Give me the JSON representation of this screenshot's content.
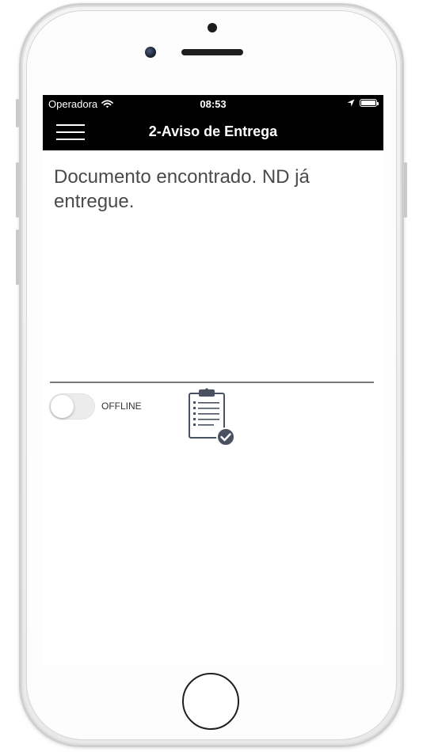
{
  "status_bar": {
    "carrier": "Operadora",
    "time": "08:53"
  },
  "nav": {
    "title": "2-Aviso de Entrega",
    "menu_icon": "hamburger-menu-icon"
  },
  "content": {
    "message": "Documento encontrado. ND já entregue."
  },
  "offline_toggle": {
    "label": "OFFLINE",
    "state": "off"
  },
  "action": {
    "icon": "clipboard-check-icon"
  },
  "colors": {
    "nav_background": "#000000",
    "message_text": "#4a4a4a",
    "icon_stroke": "#4a5160"
  }
}
